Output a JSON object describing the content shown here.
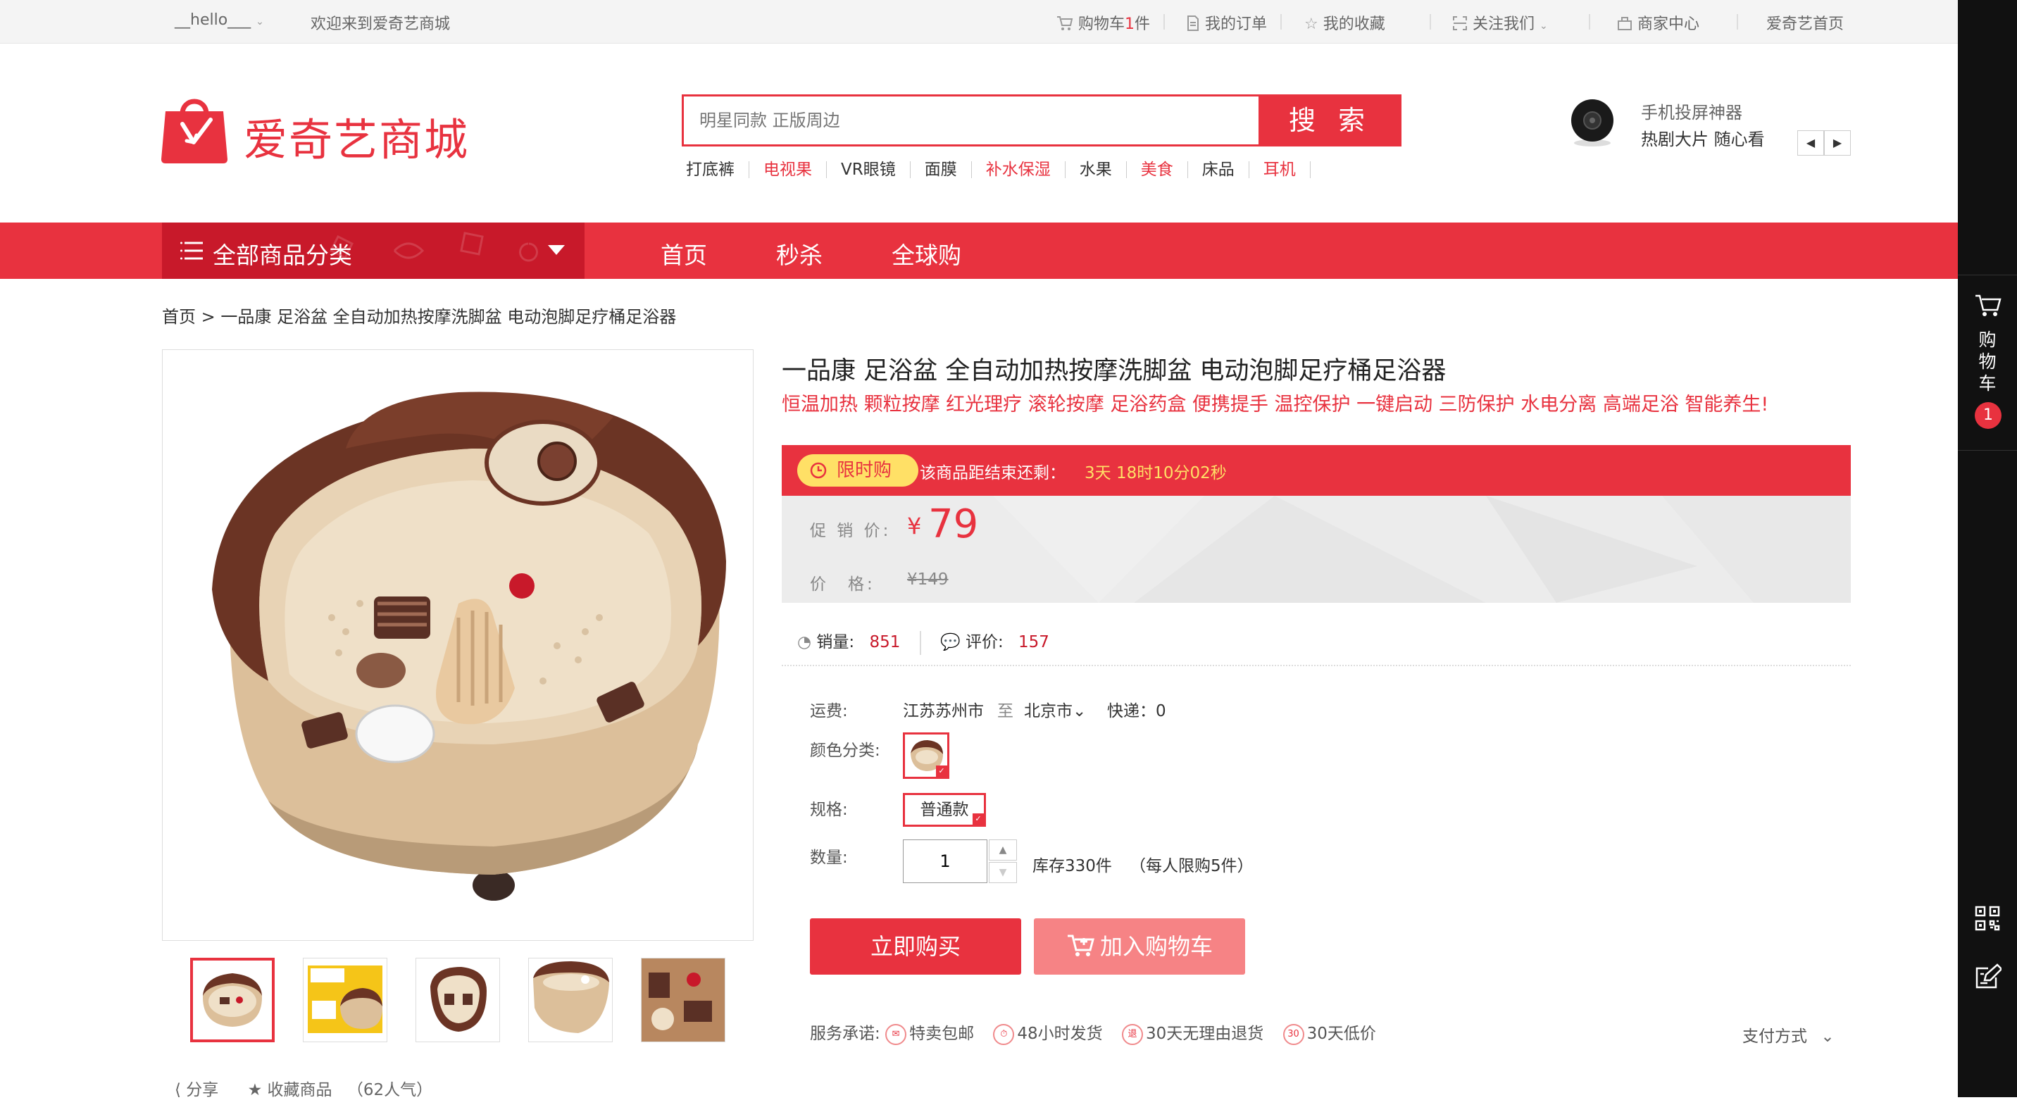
{
  "topbar": {
    "user": "__hello___",
    "welcome": "欢迎来到爱奇艺商城",
    "cart_prefix": "购物车",
    "cart_count": "1",
    "cart_suffix": "件",
    "orders": "我的订单",
    "favorites": "我的收藏",
    "follow": "关注我们",
    "merchant": "商家中心",
    "home": "爱奇艺首页"
  },
  "header": {
    "logo_text": "爱奇艺商城",
    "search_placeholder": "明星同款 正版周边",
    "search_button": "搜 索",
    "hot_words": [
      {
        "text": "打底裤",
        "hot": false
      },
      {
        "text": "电视果",
        "hot": true
      },
      {
        "text": "VR眼镜",
        "hot": false
      },
      {
        "text": "面膜",
        "hot": false
      },
      {
        "text": "补水保湿",
        "hot": true
      },
      {
        "text": "水果",
        "hot": false
      },
      {
        "text": "美食",
        "hot": true
      },
      {
        "text": "床品",
        "hot": false
      },
      {
        "text": "耳机",
        "hot": true
      }
    ],
    "promo_line1": "手机投屏神器",
    "promo_line2": "热剧大片 随心看"
  },
  "nav": {
    "all_categories": "全部商品分类",
    "links": [
      "首页",
      "秒杀",
      "全球购"
    ]
  },
  "breadcrumb": {
    "home": "首页",
    "separator": ">",
    "current": "一品康 足浴盆 全自动加热按摩洗脚盆 电动泡脚足疗桶足浴器"
  },
  "product": {
    "title": "一品康 足浴盆 全自动加热按摩洗脚盆 电动泡脚足疗桶足浴器",
    "subtitle": "恒温加热 颗粒按摩 红光理疗 滚轮按摩 足浴药盒 便携提手 温控保护 一键启动 三防保护 水电分离 高端足浴 智能养生!",
    "flash_label": "限时购",
    "flash_text": "该商品距结束还剩：",
    "flash_time": "3天 18时10分02秒",
    "promo_price_label": "促 销 价:",
    "currency": "¥",
    "promo_price": "79",
    "orig_price_label": "价　格:",
    "orig_price": "¥149",
    "sales_label": "销量:",
    "sales": "851",
    "reviews_label": "评价:",
    "reviews": "157",
    "shipping_label": "运费:",
    "ship_from": "江苏苏州市",
    "ship_to_word": "至",
    "ship_to": "北京市",
    "express": "快递：0",
    "color_label": "颜色分类:",
    "spec_label": "规格:",
    "spec_value": "普通款",
    "qty_label": "数量:",
    "qty_value": "1",
    "stock": "库存330件",
    "limit": "（每人限购5件）",
    "buy_now": "立即购买",
    "add_cart": "加入购物车",
    "services_label": "服务承诺:",
    "services": [
      "特卖包邮",
      "48小时发货",
      "30天无理由退货",
      "30天低价"
    ],
    "payment": "支付方式",
    "share": "分享",
    "favorite": "收藏商品",
    "popularity": "（62人气）"
  },
  "sidebar": {
    "cart_label": "购物车",
    "cart_badge": "1"
  },
  "colors": {
    "brand_red": "#e8323f",
    "dark_red": "#c8192a",
    "flash_yellow": "#ffe066"
  }
}
